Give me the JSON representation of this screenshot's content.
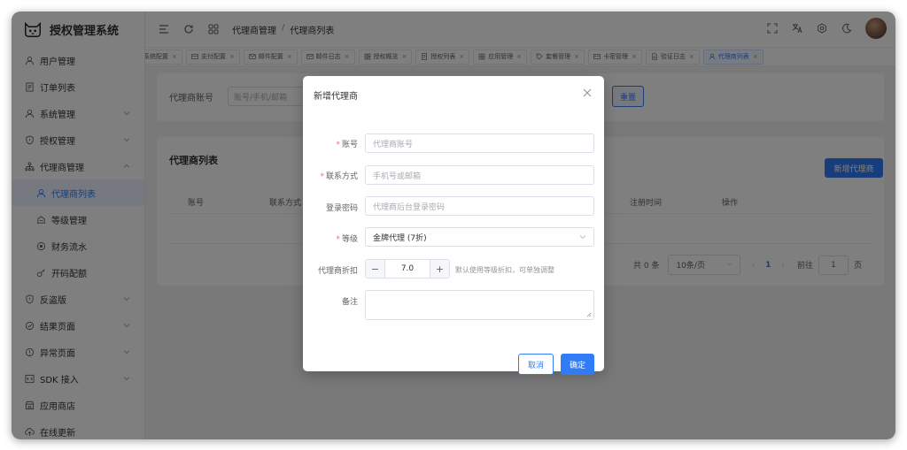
{
  "app": {
    "title": "授权管理系统"
  },
  "sidebar": {
    "items": [
      {
        "label": "用户管理",
        "icon": "user-icon",
        "arrow": false
      },
      {
        "label": "订单列表",
        "icon": "document-list-icon",
        "arrow": false
      },
      {
        "label": "系统管理",
        "icon": "user-icon",
        "arrow": true
      },
      {
        "label": "授权管理",
        "icon": "shield-icon",
        "arrow": true
      },
      {
        "label": "代理商管理",
        "icon": "org-chart-icon",
        "arrow": true,
        "expanded": true
      },
      {
        "label": "代理商列表",
        "icon": "user-icon",
        "sub": true,
        "active": true
      },
      {
        "label": "等级管理",
        "icon": "level-icon",
        "sub": true
      },
      {
        "label": "财务流水",
        "icon": "coin-icon",
        "sub": true
      },
      {
        "label": "开码配额",
        "icon": "key-icon",
        "sub": true
      },
      {
        "label": "反盗版",
        "icon": "shield-icon",
        "arrow": true
      },
      {
        "label": "结果页面",
        "icon": "check-circle-icon",
        "arrow": true
      },
      {
        "label": "异常页面",
        "icon": "warning-circle-icon",
        "arrow": true
      },
      {
        "label": "SDK 接入",
        "icon": "code-icon",
        "arrow": true
      },
      {
        "label": "应用商店",
        "icon": "store-icon",
        "arrow": false
      },
      {
        "label": "在线更新",
        "icon": "cloud-upload-icon",
        "arrow": false
      }
    ]
  },
  "header": {
    "breadcrumb": [
      "代理商管理",
      "代理商列表"
    ]
  },
  "tabs": [
    {
      "label": "系统配置",
      "icon": "",
      "active": false
    },
    {
      "label": "支付配置",
      "icon": "card-icon",
      "active": false
    },
    {
      "label": "邮件配置",
      "icon": "mail-icon",
      "active": false
    },
    {
      "label": "邮件日志",
      "icon": "mail-icon",
      "active": false
    },
    {
      "label": "授权概览",
      "icon": "grid-icon",
      "active": false
    },
    {
      "label": "授权列表",
      "icon": "document-list-icon",
      "active": false
    },
    {
      "label": "应用管理",
      "icon": "grid-icon",
      "active": false
    },
    {
      "label": "套餐管理",
      "icon": "tag-icon",
      "active": false
    },
    {
      "label": "卡密管理",
      "icon": "card-icon",
      "active": false
    },
    {
      "label": "验证日志",
      "icon": "document-icon",
      "active": false
    },
    {
      "label": "代理商列表",
      "icon": "user-icon",
      "active": true
    }
  ],
  "search": {
    "account_label": "代理商账号",
    "account_placeholder": "账号/手机/邮箱",
    "reset_label": "重置"
  },
  "list": {
    "title": "代理商列表",
    "add_button": "新增代理商",
    "columns": [
      "账号",
      "联系方式",
      "注册时间",
      "操作"
    ],
    "pagination": {
      "total": "共 0 条",
      "page_size": "10条/页",
      "current": "1",
      "goto_prefix": "前往",
      "goto_value": "1",
      "goto_suffix": "页"
    }
  },
  "dialog": {
    "title": "新增代理商",
    "fields": {
      "account": {
        "label": "账号",
        "placeholder": "代理商账号",
        "required": true
      },
      "contact": {
        "label": "联系方式",
        "placeholder": "手机号或邮箱",
        "required": true
      },
      "password": {
        "label": "登录密码",
        "placeholder": "代理商后台登录密码",
        "required": false
      },
      "level": {
        "label": "等级",
        "value": "金牌代理 (7折)",
        "required": true
      },
      "discount": {
        "label": "代理商折扣",
        "value": "7.0",
        "hint": "默认使用等级折扣，可单独调整"
      },
      "remark": {
        "label": "备注"
      }
    },
    "cancel_label": "取消",
    "confirm_label": "确定"
  },
  "colors": {
    "primary": "#2f7cf6",
    "required": "#f56c6c",
    "active_bg": "#ecf3ff"
  }
}
